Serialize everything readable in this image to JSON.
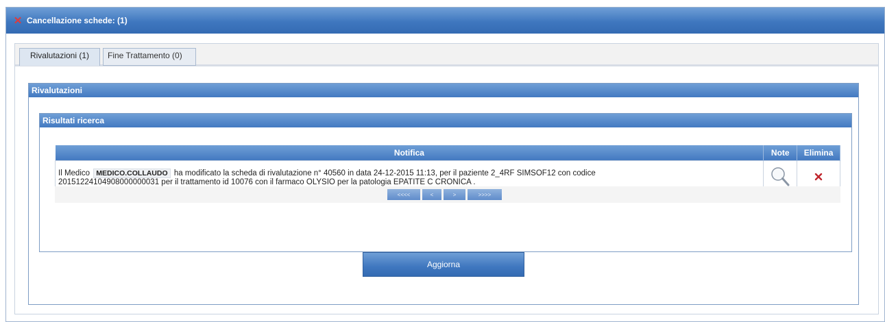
{
  "window": {
    "title": "Cancellazione schede: (1)"
  },
  "tabs": [
    {
      "label": "Rivalutazioni (1)",
      "active": true
    },
    {
      "label": "Fine Trattamento (0)",
      "active": false
    }
  ],
  "panel": {
    "title": "Rivalutazioni",
    "results_title": "Risultati ricerca"
  },
  "table": {
    "headers": {
      "notifica": "Notifica",
      "note": "Note",
      "elimina": "Elimina"
    },
    "rows": [
      {
        "prefix": "Il Medico",
        "medico": "MEDICO.COLLAUDO",
        "text_line1": "ha modificato la scheda di rivalutazione n° 40560 in data 24-12-2015 11:13, per il paziente 2_4RF SIMSOF12 con codice",
        "text_line2": "20151224104908000000031 per il trattamento id 10076 con il farmaco OLYSIO per la patologia EPATITE C CRONICA ."
      }
    ]
  },
  "pager": {
    "first": "<<<<",
    "prev": "<",
    "next": ">",
    "last": ">>>>"
  },
  "actions": {
    "aggiorna": "Aggiorna"
  },
  "icons": {
    "title_close": "close-icon",
    "note": "magnifier-icon",
    "delete": "delete-x-icon"
  },
  "colors": {
    "header_blue": "#4379c1",
    "delete_red": "#c0262d"
  }
}
